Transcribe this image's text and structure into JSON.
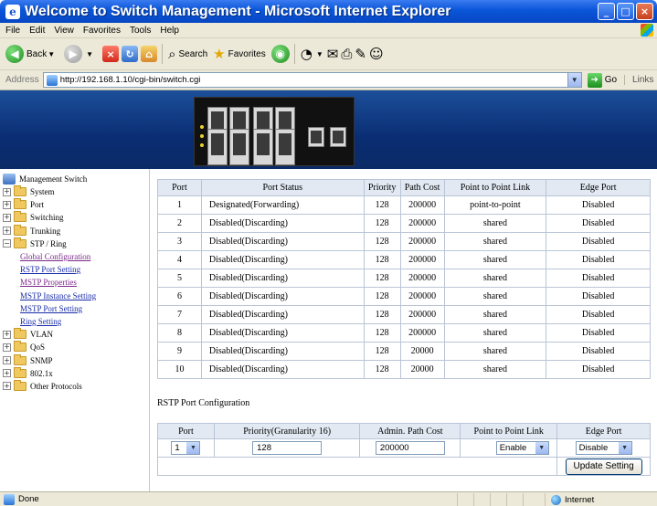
{
  "window": {
    "title": "Welcome to Switch Management - Microsoft Internet Explorer"
  },
  "menu": [
    "File",
    "Edit",
    "View",
    "Favorites",
    "Tools",
    "Help"
  ],
  "toolbar": {
    "back": "Back",
    "search": "Search",
    "favorites": "Favorites"
  },
  "address": {
    "label": "Address",
    "url": "http://192.168.1.10/cgi-bin/switch.cgi",
    "go": "Go",
    "links": "Links"
  },
  "sidebar": {
    "root": "Management Switch",
    "nodes": [
      "System",
      "Port",
      "Switching",
      "Trunking",
      "STP / Ring"
    ],
    "stp_children": [
      "Global Configuration",
      "RSTP Port Setting",
      "MSTP Properties",
      "MSTP Instance Setting",
      "MSTP Port Setting",
      "Ring Setting"
    ],
    "nodes_after": [
      "VLAN",
      "QoS",
      "SNMP",
      "802.1x",
      "Other Protocols"
    ]
  },
  "status_table": {
    "headers": [
      "Port",
      "Port Status",
      "Priority",
      "Path Cost",
      "Point to Point Link",
      "Edge Port"
    ],
    "rows": [
      [
        "1",
        "Designated(Forwarding)",
        "128",
        "200000",
        "point-to-point",
        "Disabled"
      ],
      [
        "2",
        "Disabled(Discarding)",
        "128",
        "200000",
        "shared",
        "Disabled"
      ],
      [
        "3",
        "Disabled(Discarding)",
        "128",
        "200000",
        "shared",
        "Disabled"
      ],
      [
        "4",
        "Disabled(Discarding)",
        "128",
        "200000",
        "shared",
        "Disabled"
      ],
      [
        "5",
        "Disabled(Discarding)",
        "128",
        "200000",
        "shared",
        "Disabled"
      ],
      [
        "6",
        "Disabled(Discarding)",
        "128",
        "200000",
        "shared",
        "Disabled"
      ],
      [
        "7",
        "Disabled(Discarding)",
        "128",
        "200000",
        "shared",
        "Disabled"
      ],
      [
        "8",
        "Disabled(Discarding)",
        "128",
        "200000",
        "shared",
        "Disabled"
      ],
      [
        "9",
        "Disabled(Discarding)",
        "128",
        "20000",
        "shared",
        "Disabled"
      ],
      [
        "10",
        "Disabled(Discarding)",
        "128",
        "20000",
        "shared",
        "Disabled"
      ]
    ]
  },
  "config": {
    "title": "RSTP Port Configuration",
    "headers": [
      "Port",
      "Priority(Granularity 16)",
      "Admin. Path Cost",
      "Point to Point Link",
      "Edge Port"
    ],
    "port_value": "1",
    "priority_value": "128",
    "path_cost_value": "200000",
    "p2p_value": "Enable",
    "edge_value": "Disable",
    "update_label": "Update Setting"
  },
  "status": {
    "left": "Done",
    "zone": "Internet"
  }
}
